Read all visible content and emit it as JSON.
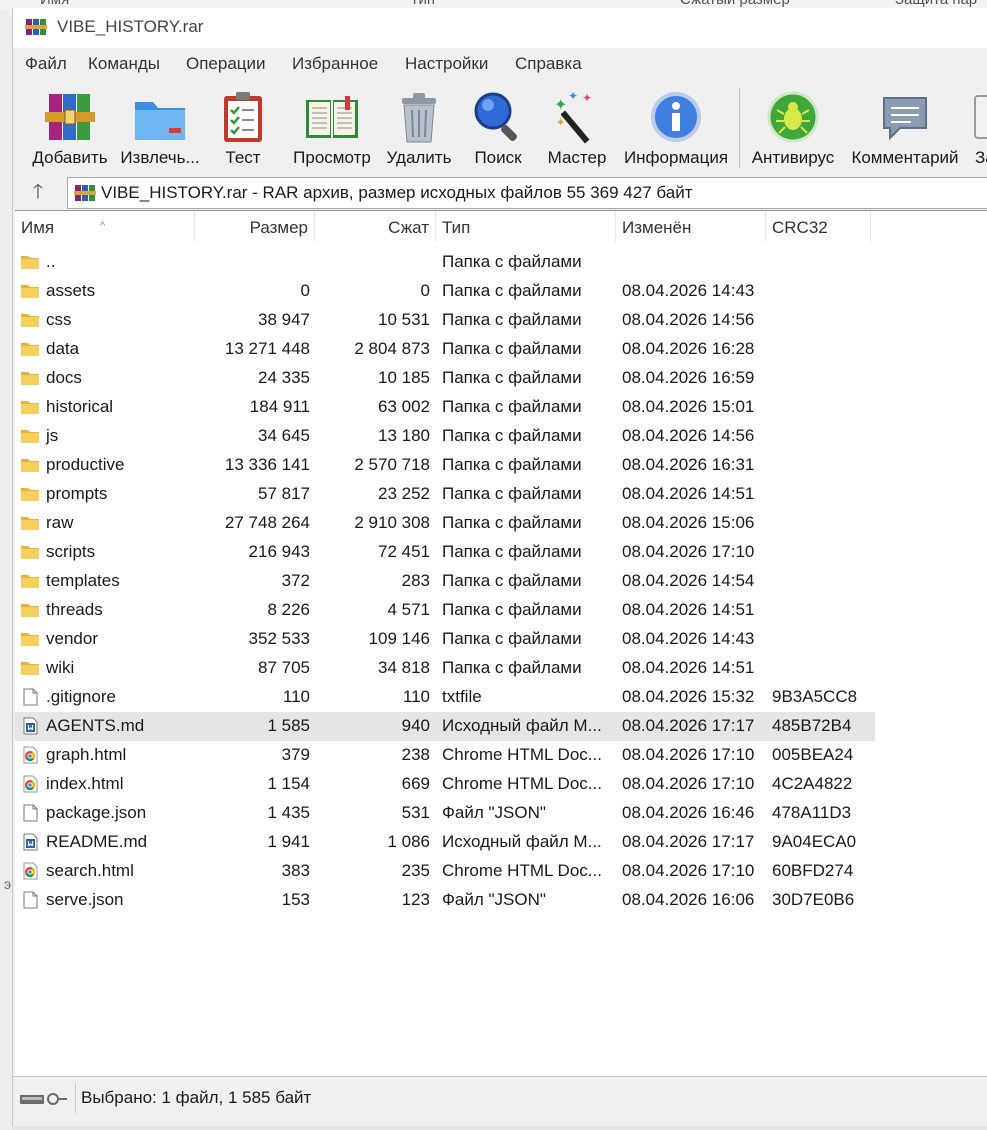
{
  "background_window": {
    "columns": [
      "Имя",
      "Тип",
      "Сжатый размер",
      "Защита пар"
    ]
  },
  "window": {
    "title": "VIBE_HISTORY.rar"
  },
  "menu": [
    "Файл",
    "Команды",
    "Операции",
    "Избранное",
    "Настройки",
    "Справка"
  ],
  "toolbar": {
    "add": "Добавить",
    "extract": "Извлечь...",
    "test": "Тест",
    "view": "Просмотр",
    "delete": "Удалить",
    "find": "Поиск",
    "wizard": "Мастер",
    "info": "Информация",
    "antivirus": "Антивирус",
    "comment": "Комментарий",
    "protect": "За"
  },
  "address": {
    "text": "VIBE_HISTORY.rar - RAR архив, размер исходных файлов 55 369 427 байт"
  },
  "columns": {
    "name": "Имя",
    "size": "Размер",
    "packed": "Сжат",
    "type": "Тип",
    "modified": "Изменён",
    "crc": "CRC32"
  },
  "files": [
    {
      "name": "..",
      "size": "",
      "packed": "",
      "type": "Папка с файлами",
      "modified": "",
      "crc": "",
      "icon": "folder-icon"
    },
    {
      "name": "assets",
      "size": "0",
      "packed": "0",
      "type": "Папка с файлами",
      "modified": "08.04.2026 14:43",
      "crc": "",
      "icon": "folder-icon"
    },
    {
      "name": "css",
      "size": "38 947",
      "packed": "10 531",
      "type": "Папка с файлами",
      "modified": "08.04.2026 14:56",
      "crc": "",
      "icon": "folder-icon"
    },
    {
      "name": "data",
      "size": "13 271 448",
      "packed": "2 804 873",
      "type": "Папка с файлами",
      "modified": "08.04.2026 16:28",
      "crc": "",
      "icon": "folder-icon"
    },
    {
      "name": "docs",
      "size": "24 335",
      "packed": "10 185",
      "type": "Папка с файлами",
      "modified": "08.04.2026 16:59",
      "crc": "",
      "icon": "folder-icon"
    },
    {
      "name": "historical",
      "size": "184 911",
      "packed": "63 002",
      "type": "Папка с файлами",
      "modified": "08.04.2026 15:01",
      "crc": "",
      "icon": "folder-icon"
    },
    {
      "name": "js",
      "size": "34 645",
      "packed": "13 180",
      "type": "Папка с файлами",
      "modified": "08.04.2026 14:56",
      "crc": "",
      "icon": "folder-icon"
    },
    {
      "name": "productive",
      "size": "13 336 141",
      "packed": "2 570 718",
      "type": "Папка с файлами",
      "modified": "08.04.2026 16:31",
      "crc": "",
      "icon": "folder-icon"
    },
    {
      "name": "prompts",
      "size": "57 817",
      "packed": "23 252",
      "type": "Папка с файлами",
      "modified": "08.04.2026 14:51",
      "crc": "",
      "icon": "folder-icon"
    },
    {
      "name": "raw",
      "size": "27 748 264",
      "packed": "2 910 308",
      "type": "Папка с файлами",
      "modified": "08.04.2026 15:06",
      "crc": "",
      "icon": "folder-icon"
    },
    {
      "name": "scripts",
      "size": "216 943",
      "packed": "72 451",
      "type": "Папка с файлами",
      "modified": "08.04.2026 17:10",
      "crc": "",
      "icon": "folder-icon"
    },
    {
      "name": "templates",
      "size": "372",
      "packed": "283",
      "type": "Папка с файлами",
      "modified": "08.04.2026 14:54",
      "crc": "",
      "icon": "folder-icon"
    },
    {
      "name": "threads",
      "size": "8 226",
      "packed": "4 571",
      "type": "Папка с файлами",
      "modified": "08.04.2026 14:51",
      "crc": "",
      "icon": "folder-icon"
    },
    {
      "name": "vendor",
      "size": "352 533",
      "packed": "109 146",
      "type": "Папка с файлами",
      "modified": "08.04.2026 14:43",
      "crc": "",
      "icon": "folder-icon"
    },
    {
      "name": "wiki",
      "size": "87 705",
      "packed": "34 818",
      "type": "Папка с файлами",
      "modified": "08.04.2026 14:51",
      "crc": "",
      "icon": "folder-icon"
    },
    {
      "name": ".gitignore",
      "size": "110",
      "packed": "110",
      "type": "txtfile",
      "modified": "08.04.2026 15:32",
      "crc": "9B3A5CC8",
      "icon": "text-file-icon"
    },
    {
      "name": "AGENTS.md",
      "size": "1 585",
      "packed": "940",
      "type": "Исходный файл M...",
      "modified": "08.04.2026 17:17",
      "crc": "485B72B4",
      "icon": "markdown-file-icon",
      "selected": true
    },
    {
      "name": "graph.html",
      "size": "379",
      "packed": "238",
      "type": "Chrome HTML Doc...",
      "modified": "08.04.2026 17:10",
      "crc": "005BEA24",
      "icon": "chrome-html-icon"
    },
    {
      "name": "index.html",
      "size": "1 154",
      "packed": "669",
      "type": "Chrome HTML Doc...",
      "modified": "08.04.2026 17:10",
      "crc": "4C2A4822",
      "icon": "chrome-html-icon"
    },
    {
      "name": "package.json",
      "size": "1 435",
      "packed": "531",
      "type": "Файл \"JSON\"",
      "modified": "08.04.2026 16:46",
      "crc": "478A11D3",
      "icon": "text-file-icon"
    },
    {
      "name": "README.md",
      "size": "1 941",
      "packed": "1 086",
      "type": "Исходный файл M...",
      "modified": "08.04.2026 17:17",
      "crc": "9A04ECA0",
      "icon": "markdown-file-icon"
    },
    {
      "name": "search.html",
      "size": "383",
      "packed": "235",
      "type": "Chrome HTML Doc...",
      "modified": "08.04.2026 17:10",
      "crc": "60BFD274",
      "icon": "chrome-html-icon"
    },
    {
      "name": "serve.json",
      "size": "153",
      "packed": "123",
      "type": "Файл \"JSON\"",
      "modified": "08.04.2026 16:06",
      "crc": "30D7E0B6",
      "icon": "text-file-icon"
    }
  ],
  "status": {
    "text": "Выбрано: 1 файл, 1 585 байт"
  },
  "colors": {
    "selection": "#e5e5e5",
    "folder": "#f4c34a",
    "title_bg": "#ffffff",
    "chrome_red": "#db4437",
    "chrome_yellow": "#f4b400",
    "chrome_green": "#0f9d58",
    "chrome_blue": "#4285f4"
  }
}
